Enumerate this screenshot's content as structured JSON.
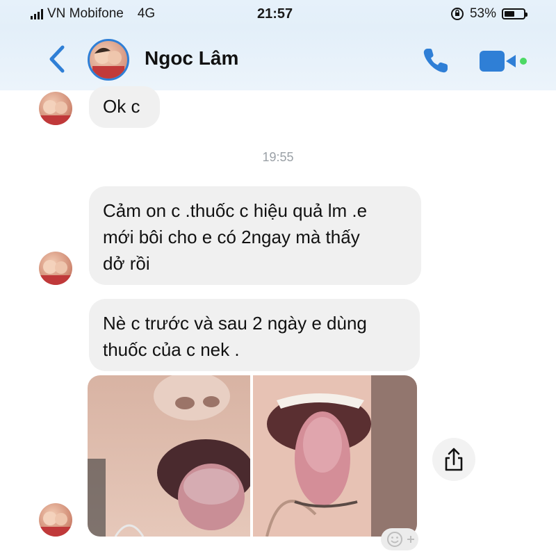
{
  "status_bar": {
    "carrier": "VN Mobifone",
    "network": "4G",
    "time": "21:57",
    "battery_percent": "53%",
    "battery_level": 0.53
  },
  "header": {
    "contact_name": "Ngoc Lâm",
    "accent_color": "#2f7fd6"
  },
  "messages": {
    "msg1": "Ok c",
    "timestamp": "19:55",
    "msg2_lines": [
      "Cảm on c .thuốc c hiệu quả lm .e",
      "mới bôi cho e có 2ngay  mà thấy",
      "dở rồi"
    ],
    "msg3_lines": [
      "Nè c trước và sau 2 ngày e dùng",
      "thuốc của c nek ."
    ]
  },
  "icons": {
    "back": "chevron-left-icon",
    "call": "phone-icon",
    "video": "video-camera-icon",
    "share": "share-icon",
    "reaction": "add-reaction-icon"
  }
}
